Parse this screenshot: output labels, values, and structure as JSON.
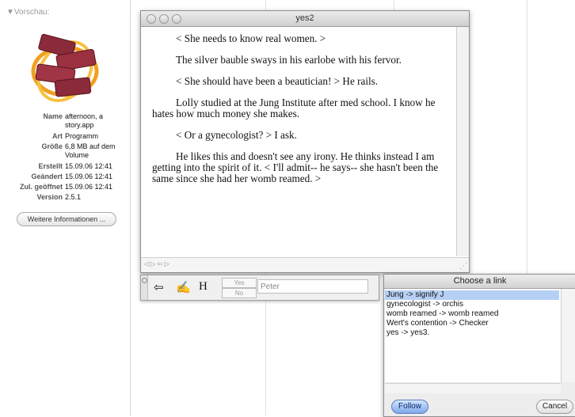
{
  "info_panel": {
    "preview_label": "▼Vorschau:",
    "rows": [
      {
        "key": "Name",
        "value": "afternoon, a story.app"
      },
      {
        "key": "Art",
        "value": "Programm"
      },
      {
        "key": "Größe",
        "value": "6,8 MB auf dem Volume"
      },
      {
        "key": "Erstellt",
        "value": "15.09.06 12:41"
      },
      {
        "key": "Geändert",
        "value": "15.09.06 12:41"
      },
      {
        "key": "Zul. geöffnet",
        "value": "15.09.06 12:41"
      },
      {
        "key": "Version",
        "value": "2.5.1"
      }
    ],
    "more_info_label": "Weitere Informationen ..."
  },
  "window": {
    "title": "yes2",
    "paragraphs": [
      "< She needs to know real women. >",
      "The silver bauble sways in his earlobe with his fervor.",
      "< She should have been a beautician! >  He rails.",
      "Lolly studied at the Jung Institute after med school.  I know he hates how much money she makes.",
      "< Or a gynecologist? > I ask.",
      "He likes this and doesn't see any irony.  He thinks instead I am getting into the spirit of it.  < I'll admit-- he says-- she hasn't been the same since she had her womb  reamed. >"
    ]
  },
  "toolbar": {
    "yes_label": "Yes",
    "no_label": "No",
    "name_placeholder": "Peter",
    "h_label": "H"
  },
  "link_dialog": {
    "title": "Choose a link",
    "links": [
      "Jung ->  signify J",
      "gynecologist ->  orchis",
      "womb reamed ->  womb reamed",
      "Wert's contention ->  Checker",
      "yes ->  yes3."
    ],
    "selected_index": 0,
    "follow_label": "Follow",
    "cancel_label": "Cancel"
  }
}
